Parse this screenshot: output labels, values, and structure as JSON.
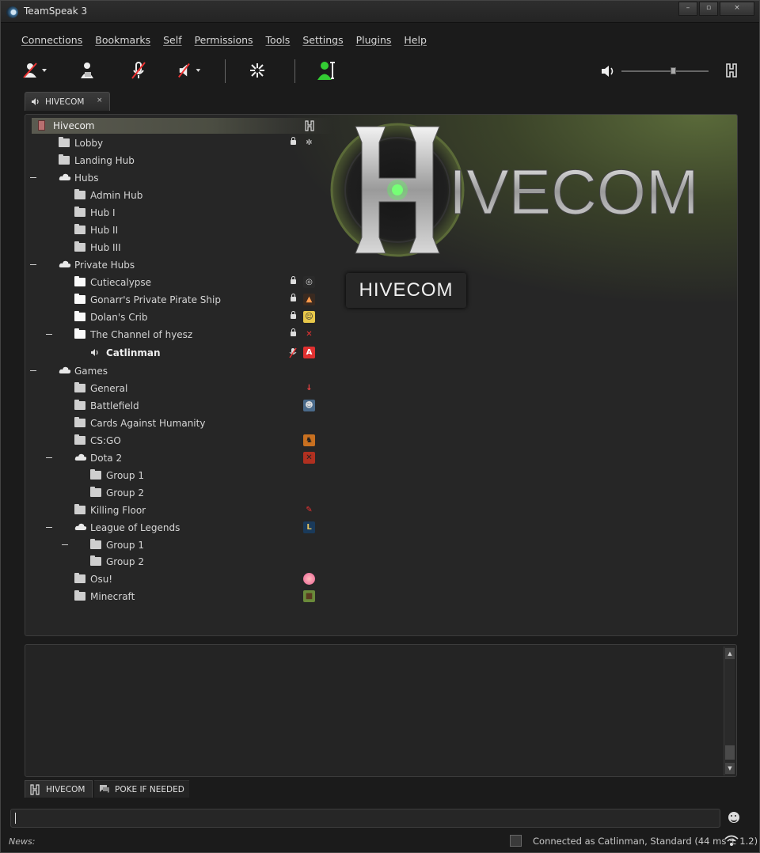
{
  "window": {
    "title": "TeamSpeak 3",
    "min": "–",
    "max": "▫",
    "close": "×"
  },
  "menu": [
    "Connections",
    "Bookmarks",
    "Self",
    "Permissions",
    "Tools",
    "Settings",
    "Plugins",
    "Help"
  ],
  "toolbar": {
    "icons": [
      "away-icon",
      "subscribe-icon",
      "mute-mic-icon",
      "mute-speaker-icon",
      "whisper-icon",
      "contacts-icon"
    ],
    "volume_level": 0.6
  },
  "server_tab": {
    "label": "HIVECOM",
    "close": "×"
  },
  "banner": {
    "logo_text": "IVECOM",
    "logo_letter": "H",
    "caption": "HIVECOM"
  },
  "tree": {
    "server": "Hivecom",
    "channels": [
      {
        "label": "Lobby"
      },
      {
        "label": "Landing Hub"
      },
      {
        "label": "Hubs"
      },
      {
        "label": "Admin Hub"
      },
      {
        "label": "Hub I"
      },
      {
        "label": "Hub II"
      },
      {
        "label": "Hub III"
      },
      {
        "label": "Private Hubs"
      },
      {
        "label": "Cutiecalypse"
      },
      {
        "label": "Gonarr's Private Pirate Ship"
      },
      {
        "label": "Dolan's Crib"
      },
      {
        "label": "The Channel of hyesz"
      },
      {
        "label": "Catlinman"
      },
      {
        "label": "Games"
      },
      {
        "label": "General"
      },
      {
        "label": "Battlefield"
      },
      {
        "label": "Cards Against Humanity"
      },
      {
        "label": "CS:GO"
      },
      {
        "label": "Dota 2"
      },
      {
        "label": "Group 1"
      },
      {
        "label": "Group 2"
      },
      {
        "label": "Killing Floor"
      },
      {
        "label": "League of Legends"
      },
      {
        "label": "Group 1"
      },
      {
        "label": "Group 2"
      },
      {
        "label": "Osu!"
      },
      {
        "label": "Minecraft"
      }
    ],
    "client_badge": "A"
  },
  "chat_tabs": [
    "HIVECOM",
    "POKE IF NEEDED"
  ],
  "chat_input": {
    "value": ""
  },
  "status": {
    "news_label": "News:",
    "connection": "Connected as Catlinman, Standard (44 ms ± 1.2)"
  },
  "colors": {
    "accent_green": "#5a6a3a",
    "client_red": "#e03030"
  }
}
